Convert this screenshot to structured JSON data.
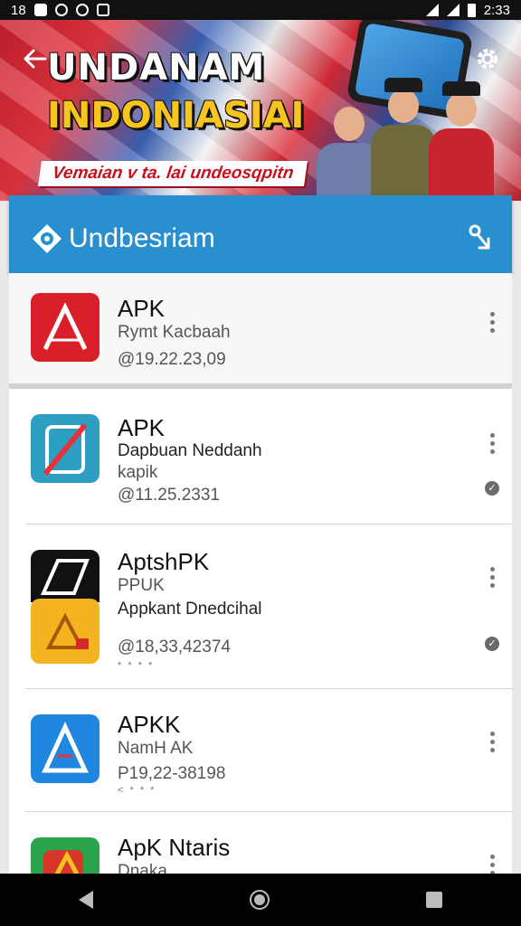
{
  "status_bar": {
    "left_text": "18",
    "time": "2:33"
  },
  "banner": {
    "title_line1": "UNDANAM",
    "title_line2": "INDONIASIAI",
    "subtitle": "Vemaian v ta. lai undeosqpitn"
  },
  "header": {
    "title": "Undbesriam"
  },
  "apps": [
    {
      "name": "APK",
      "line1": "Rymt Kacbaah",
      "line2": "",
      "line3": "@19.22.23,09",
      "stars": "",
      "verified": false
    },
    {
      "name": "APK",
      "line1": "Dapbuan Neddanh",
      "line2": "kapik",
      "line3": "@11.25.2331",
      "stars": "",
      "verified": true
    },
    {
      "name": "AptshPK",
      "line1": "PPUK",
      "line2": "Appkant Dnedcihal",
      "line3": "@18,33,42374",
      "stars": "* * * *",
      "verified": true
    },
    {
      "name": "APKK",
      "line1": "NamH AK",
      "line2": "",
      "line3": "P19,22-38198",
      "stars": "< * * *",
      "verified": false
    },
    {
      "name": "ApK Ntaris",
      "line1": "Dnaka",
      "line2": "",
      "line3": "",
      "stars": "",
      "verified": false
    }
  ],
  "colors": {
    "header": "#2a8fcf",
    "banner_red": "#c91f2e",
    "banner_yellow": "#f7c51d"
  }
}
